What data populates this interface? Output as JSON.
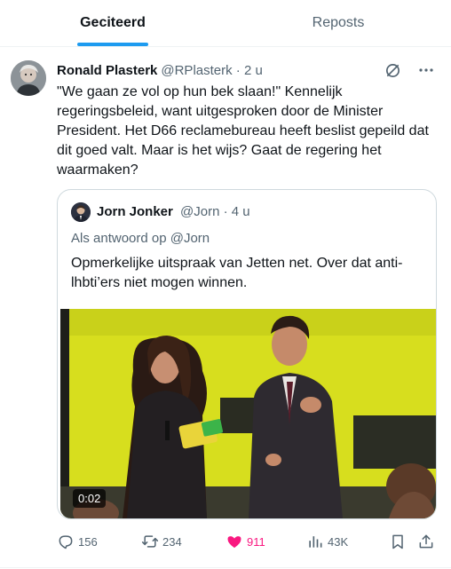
{
  "tabs": [
    {
      "label": "Geciteerd",
      "active": true
    },
    {
      "label": "Reposts",
      "active": false
    }
  ],
  "tweet": {
    "author_name": "Ronald Plasterk",
    "handle_time": "@RPlasterk · 2 u",
    "text": "\"We gaan ze vol op hun bek slaan!\" Kennelijk regeringsbeleid, want uitgesproken door de Minister President. Het D66 reclamebureau heeft beslist gepeild dat dit goed valt. Maar is het wijs? Gaat de regering het waarmaken?",
    "icons": [
      "grok-icon",
      "more-icon"
    ]
  },
  "quote": {
    "author_name": "Jorn Jonker",
    "handle_time": "@Jorn · 4 u",
    "reply_to": "Als antwoord op @Jorn",
    "text": "Opmerkelijke uitspraak van Jetten net. Over dat anti-lhbti’ers niet mogen winnen.",
    "video_time": "0:02"
  },
  "actions": {
    "replies": "156",
    "reposts": "234",
    "likes": "911",
    "views": "43K"
  },
  "colors": {
    "accent": "#1d9bf0",
    "like": "#f91880",
    "secondary": "#536471",
    "video_bg": "#d7de1e"
  }
}
